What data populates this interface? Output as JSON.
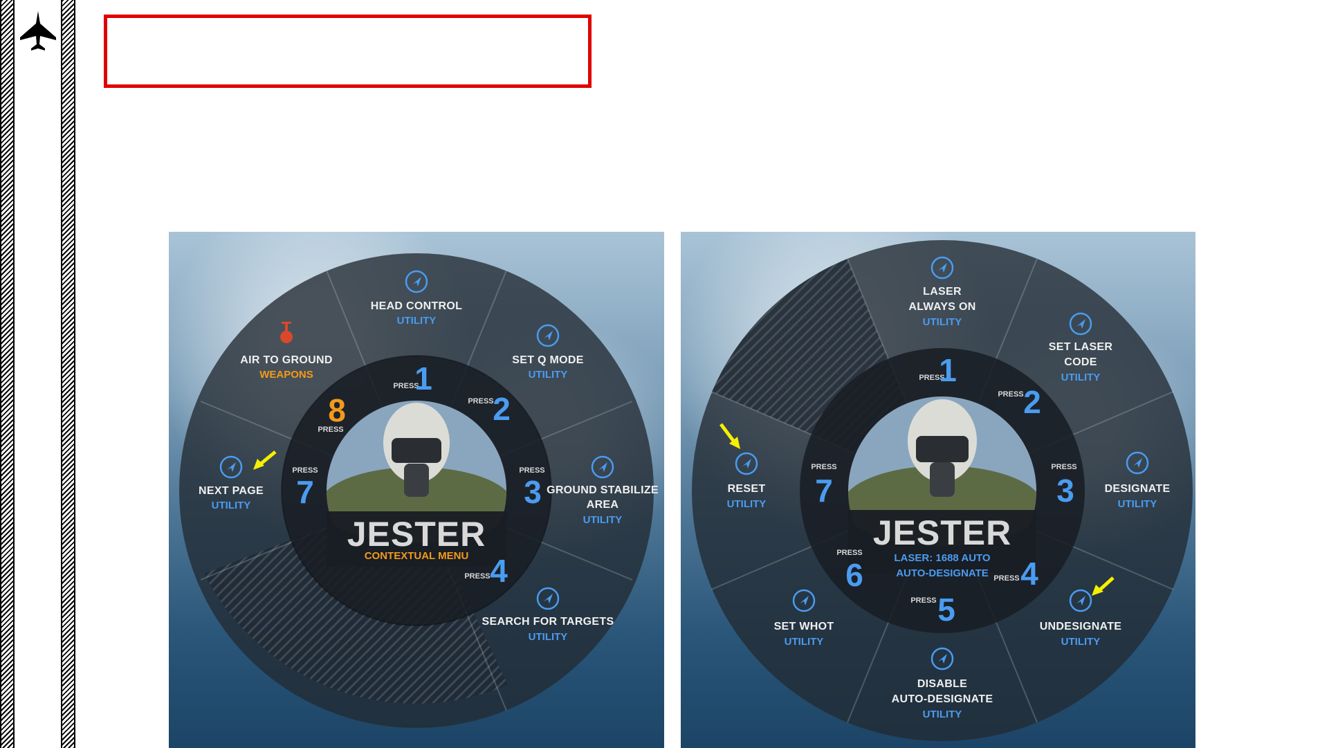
{
  "slide": {
    "title_box_text": ""
  },
  "left_menu": {
    "center": {
      "title": "JESTER",
      "subtitle": "CONTEXTUAL MENU"
    },
    "slots": [
      {
        "key": "1",
        "label_lines": [
          "HEAD CONTROL"
        ],
        "category": "UTILITY",
        "press": "PRESS",
        "number": "1"
      },
      {
        "key": "2",
        "label_lines": [
          "SET Q MODE"
        ],
        "category": "UTILITY",
        "press": "PRESS",
        "number": "2"
      },
      {
        "key": "3",
        "label_lines": [
          "GROUND STABILIZE",
          "AREA"
        ],
        "category": "UTILITY",
        "press": "PRESS",
        "number": "3"
      },
      {
        "key": "4",
        "label_lines": [
          "SEARCH FOR TARGETS"
        ],
        "category": "UTILITY",
        "press": "PRESS",
        "number": "4"
      },
      {
        "key": "7",
        "label_lines": [
          "NEXT PAGE"
        ],
        "category": "UTILITY",
        "press": "PRESS",
        "number": "7",
        "highlight_arrow": true
      },
      {
        "key": "8",
        "label_lines": [
          "AIR TO GROUND"
        ],
        "category": "WEAPONS",
        "press": "PRESS",
        "number": "8",
        "accent": "orange"
      }
    ]
  },
  "right_menu": {
    "center": {
      "title": "JESTER",
      "subtitle_lines": [
        "LASER: 1688 AUTO",
        "AUTO-DESIGNATE"
      ]
    },
    "slots": [
      {
        "key": "1",
        "label_lines": [
          "LASER",
          "ALWAYS ON"
        ],
        "category": "UTILITY",
        "press": "PRESS",
        "number": "1"
      },
      {
        "key": "2",
        "label_lines": [
          "SET LASER",
          "CODE"
        ],
        "category": "UTILITY",
        "press": "PRESS",
        "number": "2"
      },
      {
        "key": "3",
        "label_lines": [
          "DESIGNATE"
        ],
        "category": "UTILITY",
        "press": "PRESS",
        "number": "3"
      },
      {
        "key": "4",
        "label_lines": [
          "UNDESIGNATE"
        ],
        "category": "UTILITY",
        "press": "PRESS",
        "number": "4",
        "highlight_arrow": true
      },
      {
        "key": "5",
        "label_lines": [
          "DISABLE",
          "AUTO-DESIGNATE"
        ],
        "category": "UTILITY",
        "press": "PRESS",
        "number": "5"
      },
      {
        "key": "6",
        "label_lines": [
          "SET WHOT"
        ],
        "category": "UTILITY",
        "press": "PRESS",
        "number": "6"
      },
      {
        "key": "7",
        "label_lines": [
          "RESET"
        ],
        "category": "UTILITY",
        "press": "PRESS",
        "number": "7",
        "highlight_arrow": true
      }
    ]
  },
  "icons": {
    "sidebar": "fighter-jet-icon",
    "slot": "navigation-arrow-icon",
    "weapon": "bomb-icon",
    "highlight": "yellow-arrow-icon"
  },
  "colors": {
    "title_box_border": "#e00000",
    "utility_blue": "#4a9cf0",
    "weapons_orange": "#f39a1c",
    "highlight_yellow": "#f5f000"
  }
}
